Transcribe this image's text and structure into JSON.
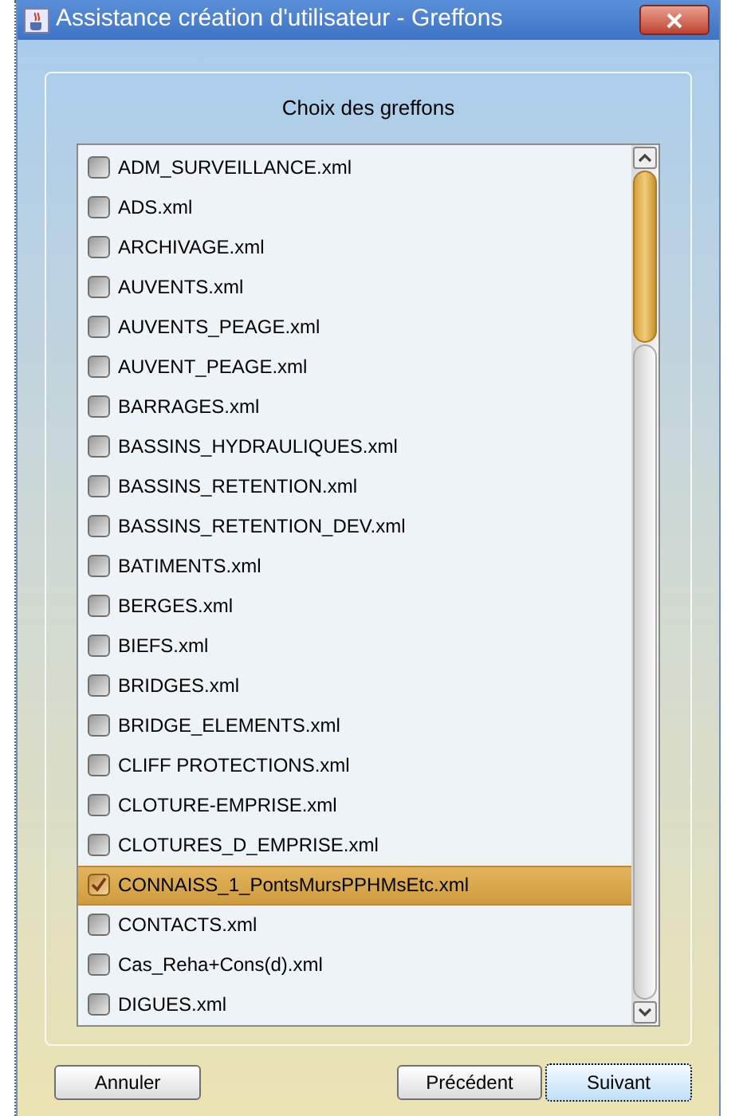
{
  "window": {
    "title": "Assistance création d'utilisateur - Greffons"
  },
  "panel": {
    "title": "Choix des greffons"
  },
  "items": [
    {
      "label": "ADM_SURVEILLANCE.xml",
      "checked": false,
      "selected": false
    },
    {
      "label": "ADS.xml",
      "checked": false,
      "selected": false
    },
    {
      "label": "ARCHIVAGE.xml",
      "checked": false,
      "selected": false
    },
    {
      "label": "AUVENTS.xml",
      "checked": false,
      "selected": false
    },
    {
      "label": "AUVENTS_PEAGE.xml",
      "checked": false,
      "selected": false
    },
    {
      "label": "AUVENT_PEAGE.xml",
      "checked": false,
      "selected": false
    },
    {
      "label": "BARRAGES.xml",
      "checked": false,
      "selected": false
    },
    {
      "label": "BASSINS_HYDRAULIQUES.xml",
      "checked": false,
      "selected": false
    },
    {
      "label": "BASSINS_RETENTION.xml",
      "checked": false,
      "selected": false
    },
    {
      "label": "BASSINS_RETENTION_DEV.xml",
      "checked": false,
      "selected": false
    },
    {
      "label": "BATIMENTS.xml",
      "checked": false,
      "selected": false
    },
    {
      "label": "BERGES.xml",
      "checked": false,
      "selected": false
    },
    {
      "label": "BIEFS.xml",
      "checked": false,
      "selected": false
    },
    {
      "label": "BRIDGES.xml",
      "checked": false,
      "selected": false
    },
    {
      "label": "BRIDGE_ELEMENTS.xml",
      "checked": false,
      "selected": false
    },
    {
      "label": "CLIFF PROTECTIONS.xml",
      "checked": false,
      "selected": false
    },
    {
      "label": "CLOTURE-EMPRISE.xml",
      "checked": false,
      "selected": false
    },
    {
      "label": "CLOTURES_D_EMPRISE.xml",
      "checked": false,
      "selected": false
    },
    {
      "label": "CONNAISS_1_PontsMursPPHMsEtc.xml",
      "checked": true,
      "selected": true
    },
    {
      "label": "CONTACTS.xml",
      "checked": false,
      "selected": false
    },
    {
      "label": "Cas_Reha+Cons(d).xml",
      "checked": false,
      "selected": false
    },
    {
      "label": "DIGUES.xml",
      "checked": false,
      "selected": false
    }
  ],
  "buttons": {
    "cancel": "Annuler",
    "previous": "Précédent",
    "next": "Suivant"
  }
}
